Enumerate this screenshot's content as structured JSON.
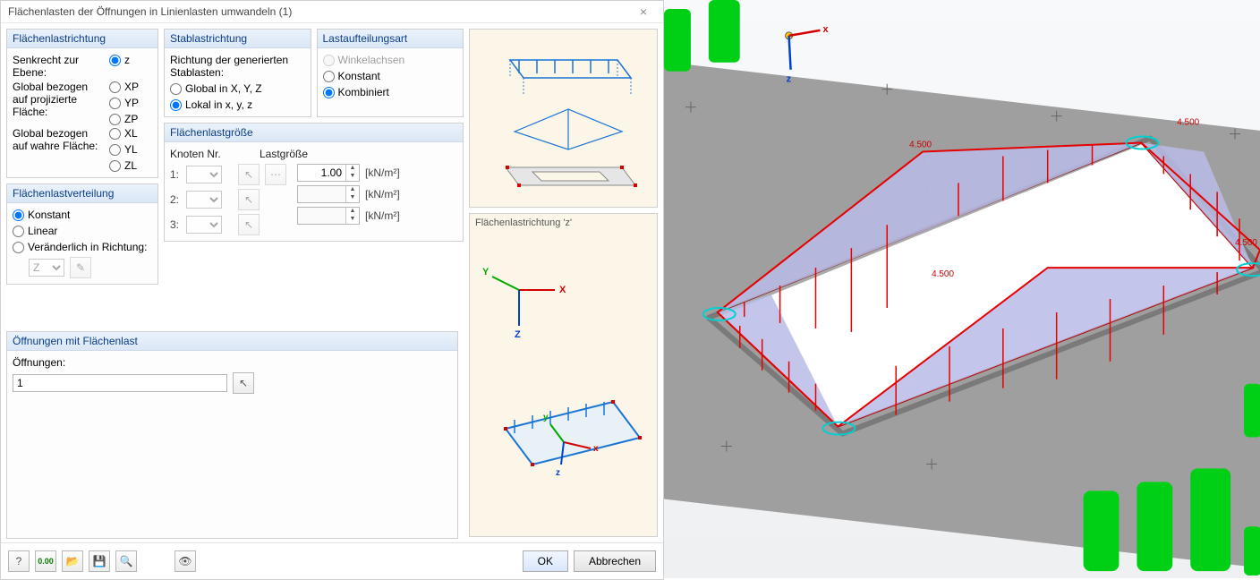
{
  "dialog": {
    "title": "Flächenlasten der Öffnungen in Linienlasten umwandeln   (1)",
    "close": "×",
    "groups": {
      "flr": {
        "title": "Flächenlastrichtung",
        "row1_label": "Senkrecht zur Ebene:",
        "row1_opts": [
          "z"
        ],
        "row2_label": "Global bezogen auf projizierte Fläche:",
        "row2_opts": [
          "XP",
          "YP",
          "ZP"
        ],
        "row3_label": "Global bezogen auf wahre Fläche:",
        "row3_opts": [
          "XL",
          "YL",
          "ZL"
        ]
      },
      "stab": {
        "title": "Stablastrichtung",
        "caption": "Richtung der generierten Stablasten:",
        "opts": [
          "Global in X, Y, Z",
          "Lokal in x, y, z"
        ]
      },
      "laa": {
        "title": "Lastaufteilungsart",
        "opts": [
          "Winkelachsen",
          "Konstant",
          "Kombiniert"
        ]
      },
      "flv": {
        "title": "Flächenlastverteilung",
        "opts": [
          "Konstant",
          "Linear",
          "Veränderlich in Richtung:"
        ],
        "axis": "Z"
      },
      "flg": {
        "title": "Flächenlastgröße",
        "col1": "Knoten Nr.",
        "col2": "Lastgröße",
        "rows": [
          "1:",
          "2:",
          "3:"
        ],
        "val1": "1.00",
        "unit": "[kN/m²]"
      },
      "open": {
        "title": "Öffnungen mit Flächenlast",
        "label": "Öffnungen:",
        "value": "1"
      }
    },
    "preview2_caption": "Flächenlastrichtung 'z'",
    "buttons": {
      "ok": "OK",
      "cancel": "Abbrechen"
    }
  },
  "viewport": {
    "load_values": [
      "4.500",
      "4.500",
      "4.500",
      "4.500"
    ],
    "axes": [
      "x",
      "z"
    ]
  },
  "chart_data": {
    "type": "diagram",
    "description": "3D structural slab with rectangular opening; trapezoidal line loads on opening edges",
    "load_magnitude_kN_per_m": 4.5,
    "edges_loaded": 4,
    "load_shape": "triangular (0 at corners, peak mid-span)",
    "axis_system": "global x (red, right), z (blue, down)"
  }
}
